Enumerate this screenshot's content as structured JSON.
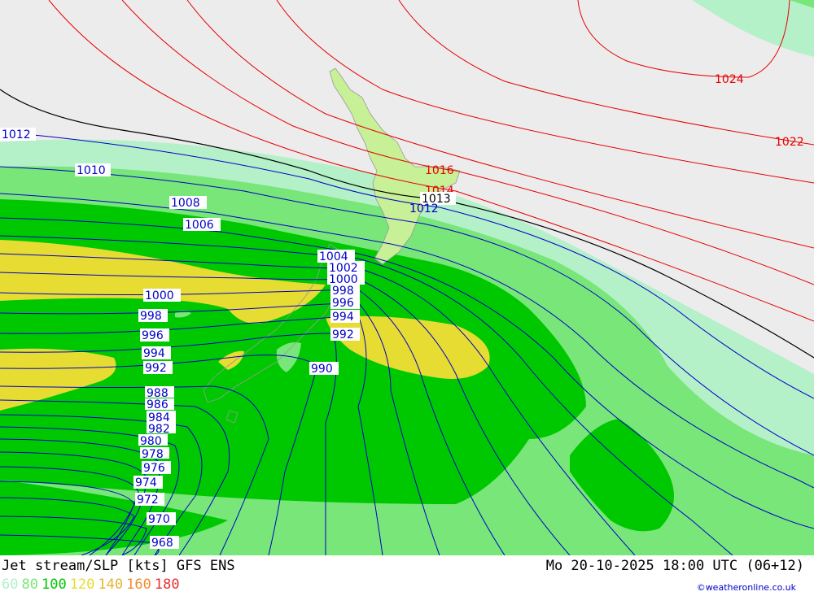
{
  "map": {
    "labels": {
      "l1024": "1024",
      "l1022": "1022",
      "l1016": "1016",
      "l1014": "1014",
      "l1013": "1013",
      "l1012a": "1012",
      "l1012b": "1012",
      "l1010": "1010",
      "l1008": "1008",
      "l1006": "1006",
      "l1004": "1004",
      "l1002": "1002",
      "l1000a": "1000",
      "l1000b": "1000",
      "l998a": "998",
      "l998b": "998",
      "l996a": "996",
      "l996b": "996",
      "l994a": "994",
      "l994b": "994",
      "l992a": "992",
      "l992b": "992",
      "l990": "990",
      "l988": "988",
      "l986": "986",
      "l984": "984",
      "l982": "982",
      "l980": "980",
      "l978": "978",
      "l976": "976",
      "l974": "974",
      "l972": "972",
      "l970": "970",
      "l968": "968"
    }
  },
  "footer": {
    "title": "Jet stream/SLP [kts] GFS ENS",
    "datetime": "Mo 20-10-2025 18:00 UTC (06+12)",
    "legend": [
      {
        "label": "60",
        "color": "#b4f0c8"
      },
      {
        "label": "80",
        "color": "#78e678"
      },
      {
        "label": "100",
        "color": "#00c800"
      },
      {
        "label": "120",
        "color": "#e6dc32"
      },
      {
        "label": "140",
        "color": "#e6b432"
      },
      {
        "label": "160",
        "color": "#f08c32"
      },
      {
        "label": "180",
        "color": "#e63232"
      }
    ],
    "credit": "©weatheronline.co.uk"
  },
  "colors": {
    "background": "#ececec",
    "low_pressure_isobar": "#0000c8",
    "high_pressure_isobar": "#e60000",
    "reference_isobar": "#000000",
    "land_fill": "#c8f096"
  }
}
